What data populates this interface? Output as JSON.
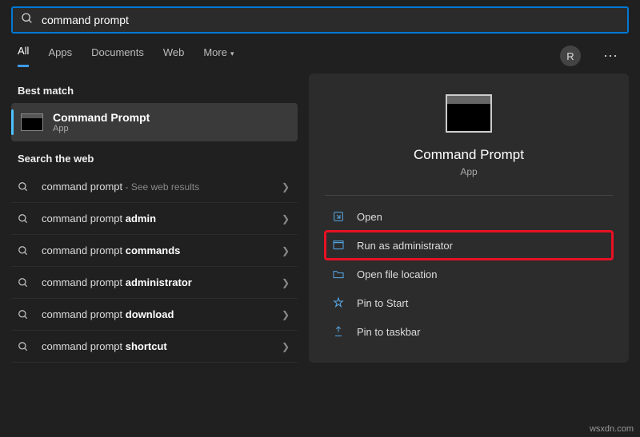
{
  "search": {
    "value": "command prompt"
  },
  "tabs": {
    "items": [
      "All",
      "Apps",
      "Documents",
      "Web",
      "More"
    ],
    "active": 0
  },
  "avatar_letter": "R",
  "left": {
    "best_match_label": "Best match",
    "best_match": {
      "title": "Command Prompt",
      "subtitle": "App"
    },
    "search_web_label": "Search the web",
    "web_items": [
      {
        "prefix": "command prompt",
        "bold": "",
        "hint": " - See web results"
      },
      {
        "prefix": "command prompt ",
        "bold": "admin",
        "hint": ""
      },
      {
        "prefix": "command prompt ",
        "bold": "commands",
        "hint": ""
      },
      {
        "prefix": "command prompt ",
        "bold": "administrator",
        "hint": ""
      },
      {
        "prefix": "command prompt ",
        "bold": "download",
        "hint": ""
      },
      {
        "prefix": "command prompt ",
        "bold": "shortcut",
        "hint": ""
      }
    ]
  },
  "right": {
    "title": "Command Prompt",
    "subtitle": "App",
    "actions": [
      {
        "icon": "open",
        "label": "Open",
        "highlight": false
      },
      {
        "icon": "admin",
        "label": "Run as administrator",
        "highlight": true
      },
      {
        "icon": "folder",
        "label": "Open file location",
        "highlight": false
      },
      {
        "icon": "pin-start",
        "label": "Pin to Start",
        "highlight": false
      },
      {
        "icon": "pin-taskbar",
        "label": "Pin to taskbar",
        "highlight": false
      }
    ]
  },
  "watermark": "wsxdn.com"
}
